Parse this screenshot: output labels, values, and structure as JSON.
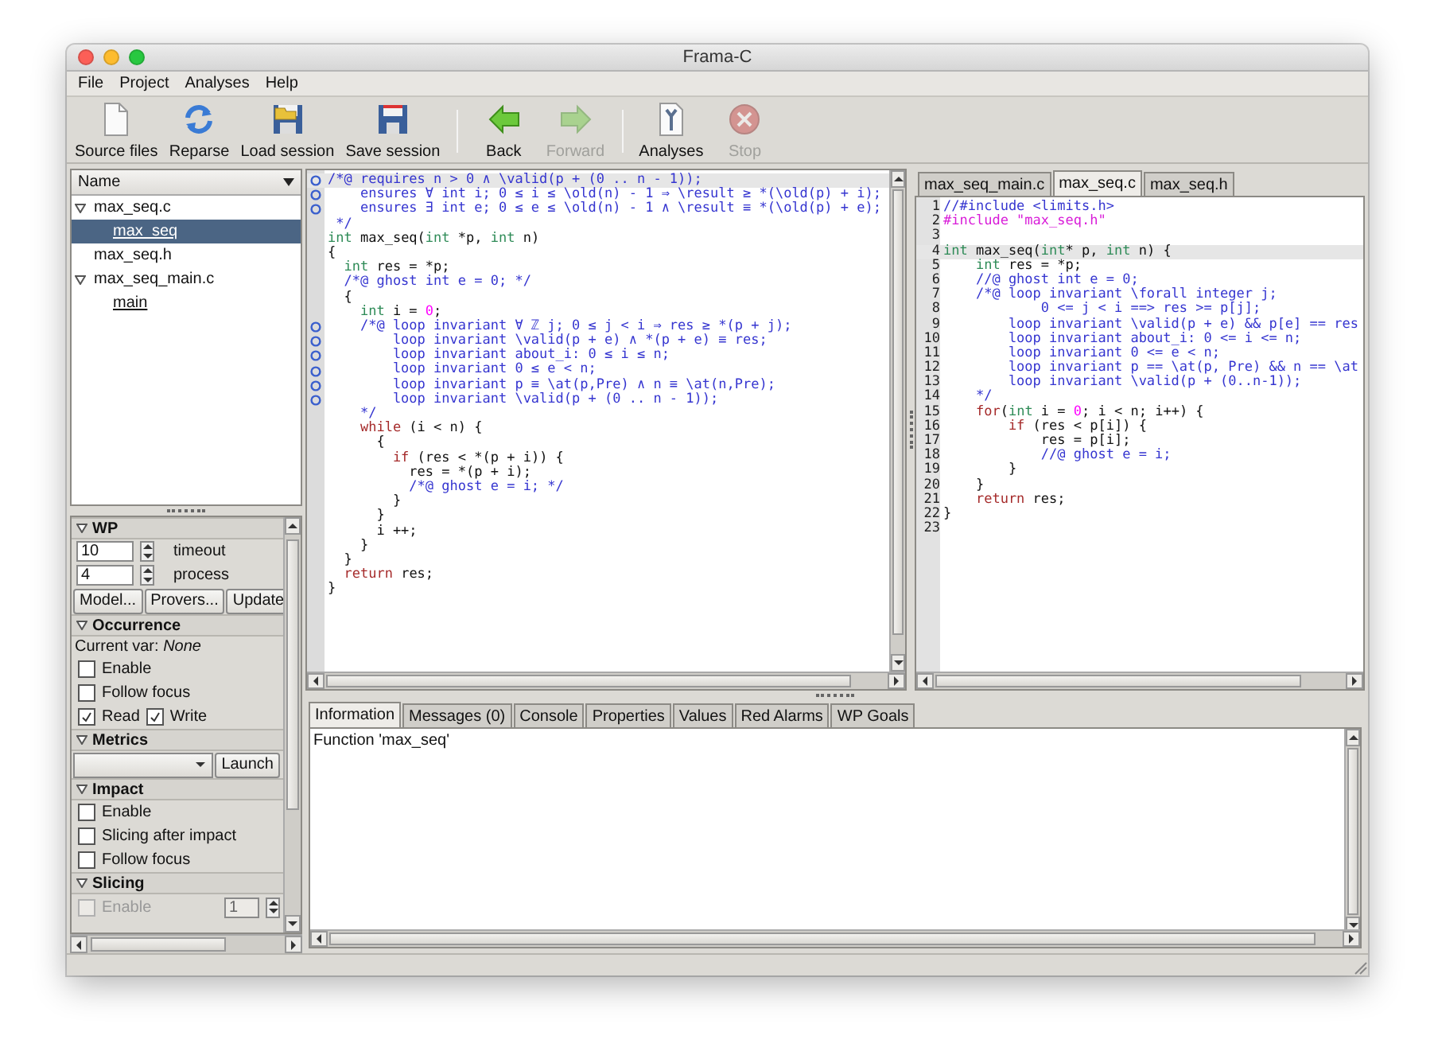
{
  "window": {
    "title": "Frama-C"
  },
  "menu": [
    "File",
    "Project",
    "Analyses",
    "Help"
  ],
  "toolbar": [
    {
      "kind": "button",
      "label": "Source files",
      "disabled": false
    },
    {
      "kind": "button",
      "label": "Reparse",
      "disabled": false
    },
    {
      "kind": "button",
      "label": "Load session",
      "disabled": false
    },
    {
      "kind": "button",
      "label": "Save session",
      "disabled": false
    },
    {
      "kind": "separator"
    },
    {
      "kind": "button",
      "label": "Back",
      "disabled": false
    },
    {
      "kind": "button",
      "label": "Forward",
      "disabled": true
    },
    {
      "kind": "separator"
    },
    {
      "kind": "button",
      "label": "Analyses",
      "disabled": false
    },
    {
      "kind": "button",
      "label": "Stop",
      "disabled": true
    }
  ],
  "tree": {
    "column": "Name",
    "items": [
      {
        "kind": "file",
        "label": "max_seq.c",
        "expanded": true,
        "selected": false,
        "children": [
          {
            "kind": "function",
            "label": "max_seq",
            "selected": true
          }
        ]
      },
      {
        "kind": "file",
        "label": "max_seq.h",
        "selected": false
      },
      {
        "kind": "file",
        "label": "max_seq_main.c",
        "expanded": true,
        "selected": false,
        "children": [
          {
            "kind": "function",
            "label": "main",
            "selected": false
          }
        ]
      }
    ]
  },
  "plugins": [
    {
      "title": "WP",
      "expanded": true,
      "items": [
        {
          "kind": "spin",
          "value": "10",
          "label": "timeout"
        },
        {
          "kind": "spin",
          "value": "4",
          "label": "process"
        },
        {
          "kind": "buttons",
          "buttons": [
            "Model...",
            "Provers...",
            "Update"
          ]
        }
      ]
    },
    {
      "title": "Occurrence",
      "expanded": true,
      "items": [
        {
          "kind": "info",
          "text": "Current var: *None*"
        },
        {
          "kind": "check",
          "label": "Enable",
          "checked": false
        },
        {
          "kind": "check",
          "label": "Follow focus",
          "checked": false
        },
        {
          "kind": "checks",
          "checks": [
            {
              "label": "Read",
              "checked": true
            },
            {
              "label": "Write",
              "checked": true
            }
          ]
        }
      ]
    },
    {
      "title": "Metrics",
      "expanded": true,
      "items": [
        {
          "kind": "combo",
          "button": "Launch"
        }
      ]
    },
    {
      "title": "Impact",
      "expanded": true,
      "items": [
        {
          "kind": "check",
          "label": "Enable",
          "checked": false
        },
        {
          "kind": "check",
          "label": "Slicing after impact",
          "checked": false
        },
        {
          "kind": "check",
          "label": "Follow focus",
          "checked": false
        }
      ]
    },
    {
      "title": "Slicing",
      "expanded": true,
      "items": [
        {
          "kind": "spin_check",
          "label": "Enable",
          "checked": false,
          "disabled": true,
          "value": "1"
        }
      ]
    }
  ],
  "source_view": {
    "lines": [
      {
        "marker": true,
        "current": true,
        "tokens": [
          {
            "kind": "acsl",
            "text": "/*@ requires n > 0 ∧ \\valid(p + (0 .. n - 1));"
          }
        ]
      },
      {
        "marker": true,
        "current": false,
        "tokens": [
          {
            "kind": "acsl",
            "text": "    ensures ∀ int i; 0 ≤ i ≤ \\old(n) - 1 ⇒ \\result ≥ *(\\old(p) + i);"
          }
        ]
      },
      {
        "marker": true,
        "current": false,
        "tokens": [
          {
            "kind": "acsl",
            "text": "    ensures ∃ int e; 0 ≤ e ≤ \\old(n) - 1 ∧ \\result ≡ *(\\old(p) + e);"
          }
        ]
      },
      {
        "marker": false,
        "current": false,
        "tokens": [
          {
            "kind": "acsl",
            "text": " */"
          }
        ]
      },
      {
        "marker": false,
        "current": false,
        "tokens": [
          {
            "kind": "type",
            "text": "int"
          },
          {
            "kind": "code",
            "text": " max_seq("
          },
          {
            "kind": "type",
            "text": "int"
          },
          {
            "kind": "code",
            "text": " *p, "
          },
          {
            "kind": "type",
            "text": "int"
          },
          {
            "kind": "code",
            "text": " n)"
          }
        ]
      },
      {
        "marker": false,
        "current": false,
        "tokens": [
          {
            "kind": "code",
            "text": "{"
          }
        ]
      },
      {
        "marker": false,
        "current": false,
        "tokens": [
          {
            "kind": "type",
            "text": "  int"
          },
          {
            "kind": "code",
            "text": " res = *p;"
          }
        ]
      },
      {
        "marker": false,
        "current": false,
        "tokens": [
          {
            "kind": "acsl",
            "text": "  /*@ ghost int e = 0; */"
          }
        ]
      },
      {
        "marker": false,
        "current": false,
        "tokens": [
          {
            "kind": "code",
            "text": "  {"
          }
        ]
      },
      {
        "marker": false,
        "current": false,
        "tokens": [
          {
            "kind": "type",
            "text": "    int"
          },
          {
            "kind": "code",
            "text": " i = "
          },
          {
            "kind": "num",
            "text": "0"
          },
          {
            "kind": "code",
            "text": ";"
          }
        ]
      },
      {
        "marker": true,
        "current": false,
        "tokens": [
          {
            "kind": "acsl",
            "text": "    /*@ loop invariant ∀ ℤ j; 0 ≤ j < i ⇒ res ≥ *(p + j);"
          }
        ]
      },
      {
        "marker": true,
        "current": false,
        "tokens": [
          {
            "kind": "acsl",
            "text": "        loop invariant \\valid(p + e) ∧ *(p + e) ≡ res;"
          }
        ]
      },
      {
        "marker": true,
        "current": false,
        "tokens": [
          {
            "kind": "acsl",
            "text": "        loop invariant about_i: 0 ≤ i ≤ n;"
          }
        ]
      },
      {
        "marker": true,
        "current": false,
        "tokens": [
          {
            "kind": "acsl",
            "text": "        loop invariant 0 ≤ e < n;"
          }
        ]
      },
      {
        "marker": true,
        "current": false,
        "tokens": [
          {
            "kind": "acsl",
            "text": "        loop invariant p ≡ \\at(p,Pre) ∧ n ≡ \\at(n,Pre);"
          }
        ]
      },
      {
        "marker": true,
        "current": false,
        "tokens": [
          {
            "kind": "acsl",
            "text": "        loop invariant \\valid(p + (0 .. n - 1));"
          }
        ]
      },
      {
        "marker": false,
        "current": false,
        "tokens": [
          {
            "kind": "acsl",
            "text": "    */"
          }
        ]
      },
      {
        "marker": false,
        "current": false,
        "tokens": [
          {
            "kind": "ctrl",
            "text": "    while"
          },
          {
            "kind": "code",
            "text": " (i < n) {"
          }
        ]
      },
      {
        "marker": false,
        "current": false,
        "tokens": [
          {
            "kind": "code",
            "text": "      {"
          }
        ]
      },
      {
        "marker": false,
        "current": false,
        "tokens": [
          {
            "kind": "ctrl",
            "text": "        if"
          },
          {
            "kind": "code",
            "text": " (res < *(p + i)) {"
          }
        ]
      },
      {
        "marker": false,
        "current": false,
        "tokens": [
          {
            "kind": "code",
            "text": "          res = *(p + i);"
          }
        ]
      },
      {
        "marker": false,
        "current": false,
        "tokens": [
          {
            "kind": "acsl",
            "text": "          /*@ ghost e = i; */"
          }
        ]
      },
      {
        "marker": false,
        "current": false,
        "tokens": [
          {
            "kind": "code",
            "text": "        }"
          }
        ]
      },
      {
        "marker": false,
        "current": false,
        "tokens": [
          {
            "kind": "code",
            "text": "      }"
          }
        ]
      },
      {
        "marker": false,
        "current": false,
        "tokens": [
          {
            "kind": "code",
            "text": "      i ++;"
          }
        ]
      },
      {
        "marker": false,
        "current": false,
        "tokens": [
          {
            "kind": "code",
            "text": "    }"
          }
        ]
      },
      {
        "marker": false,
        "current": false,
        "tokens": [
          {
            "kind": "code",
            "text": "  }"
          }
        ]
      },
      {
        "marker": false,
        "current": false,
        "tokens": [
          {
            "kind": "ctrl",
            "text": "  return"
          },
          {
            "kind": "code",
            "text": " res;"
          }
        ]
      },
      {
        "marker": false,
        "current": false,
        "tokens": [
          {
            "kind": "code",
            "text": "}"
          }
        ]
      }
    ]
  },
  "file_view": {
    "tabs": [
      {
        "label": "max_seq_main.c",
        "selected": false
      },
      {
        "label": "max_seq.c",
        "selected": true
      },
      {
        "label": "max_seq.h",
        "selected": false
      }
    ],
    "lines": [
      {
        "number": "1",
        "current": false,
        "tokens": [
          {
            "kind": "acsl",
            "text": "//#include <limits.h>"
          }
        ]
      },
      {
        "number": "2",
        "current": false,
        "tokens": [
          {
            "kind": "pre",
            "text": "#include \"max_seq.h\""
          }
        ]
      },
      {
        "number": "3",
        "current": false
      },
      {
        "number": "4",
        "current": true,
        "tokens": [
          {
            "kind": "type",
            "text": "int"
          },
          {
            "kind": "code",
            "text": " max_seq("
          },
          {
            "kind": "type",
            "text": "int"
          },
          {
            "kind": "code",
            "text": "* p, "
          },
          {
            "kind": "type",
            "text": "int"
          },
          {
            "kind": "code",
            "text": " n) {"
          }
        ]
      },
      {
        "number": "5",
        "current": false,
        "tokens": [
          {
            "kind": "type",
            "text": "    int"
          },
          {
            "kind": "code",
            "text": " res = *p;"
          }
        ]
      },
      {
        "number": "6",
        "current": false,
        "tokens": [
          {
            "kind": "acsl",
            "text": "    //@ ghost int e = 0;"
          }
        ]
      },
      {
        "number": "7",
        "current": false,
        "tokens": [
          {
            "kind": "acsl",
            "text": "    /*@ loop invariant \\forall integer j;"
          }
        ]
      },
      {
        "number": "8",
        "current": false,
        "tokens": [
          {
            "kind": "acsl",
            "text": "            0 <= j < i ==> res >= p[j];"
          }
        ]
      },
      {
        "number": "9",
        "current": false,
        "tokens": [
          {
            "kind": "acsl",
            "text": "        loop invariant \\valid(p + e) && p[e] == res"
          }
        ]
      },
      {
        "number": "10",
        "current": false,
        "tokens": [
          {
            "kind": "acsl",
            "text": "        loop invariant about_i: 0 <= i <= n;"
          }
        ]
      },
      {
        "number": "11",
        "current": false,
        "tokens": [
          {
            "kind": "acsl",
            "text": "        loop invariant 0 <= e < n;"
          }
        ]
      },
      {
        "number": "12",
        "current": false,
        "tokens": [
          {
            "kind": "acsl",
            "text": "        loop invariant p == \\at(p, Pre) && n == \\at"
          }
        ]
      },
      {
        "number": "13",
        "current": false,
        "tokens": [
          {
            "kind": "acsl",
            "text": "        loop invariant \\valid(p + (0..n-1));"
          }
        ]
      },
      {
        "number": "14",
        "current": false,
        "tokens": [
          {
            "kind": "acsl",
            "text": "    */"
          }
        ]
      },
      {
        "number": "15",
        "current": false,
        "tokens": [
          {
            "kind": "ctrl",
            "text": "    for"
          },
          {
            "kind": "code",
            "text": "("
          },
          {
            "kind": "type",
            "text": "int"
          },
          {
            "kind": "code",
            "text": " i = "
          },
          {
            "kind": "num",
            "text": "0"
          },
          {
            "kind": "code",
            "text": "; i < n; i++) {"
          }
        ]
      },
      {
        "number": "16",
        "current": false,
        "tokens": [
          {
            "kind": "ctrl",
            "text": "        if"
          },
          {
            "kind": "code",
            "text": " (res < p[i]) {"
          }
        ]
      },
      {
        "number": "17",
        "current": false,
        "tokens": [
          {
            "kind": "code",
            "text": "            res = p[i];"
          }
        ]
      },
      {
        "number": "18",
        "current": false,
        "tokens": [
          {
            "kind": "acsl",
            "text": "            //@ ghost e = i;"
          }
        ]
      },
      {
        "number": "19",
        "current": false,
        "tokens": [
          {
            "kind": "code",
            "text": "        }"
          }
        ]
      },
      {
        "number": "20",
        "current": false,
        "tokens": [
          {
            "kind": "code",
            "text": "    }"
          }
        ]
      },
      {
        "number": "21",
        "current": false,
        "tokens": [
          {
            "kind": "ctrl",
            "text": "    return"
          },
          {
            "kind": "code",
            "text": " res;"
          }
        ]
      },
      {
        "number": "22",
        "current": false,
        "tokens": [
          {
            "kind": "code",
            "text": "}"
          }
        ]
      },
      {
        "number": "23",
        "current": false
      }
    ]
  },
  "bottom_panel": {
    "tabs": [
      {
        "label": "Information",
        "selected": true
      },
      {
        "label": "Messages (0)",
        "selected": false
      },
      {
        "label": "Console",
        "selected": false
      },
      {
        "label": "Properties",
        "selected": false
      },
      {
        "label": "Values",
        "selected": false
      },
      {
        "label": "Red Alarms",
        "selected": false
      },
      {
        "label": "WP Goals",
        "selected": false
      }
    ],
    "text": "Function 'max_seq'"
  }
}
